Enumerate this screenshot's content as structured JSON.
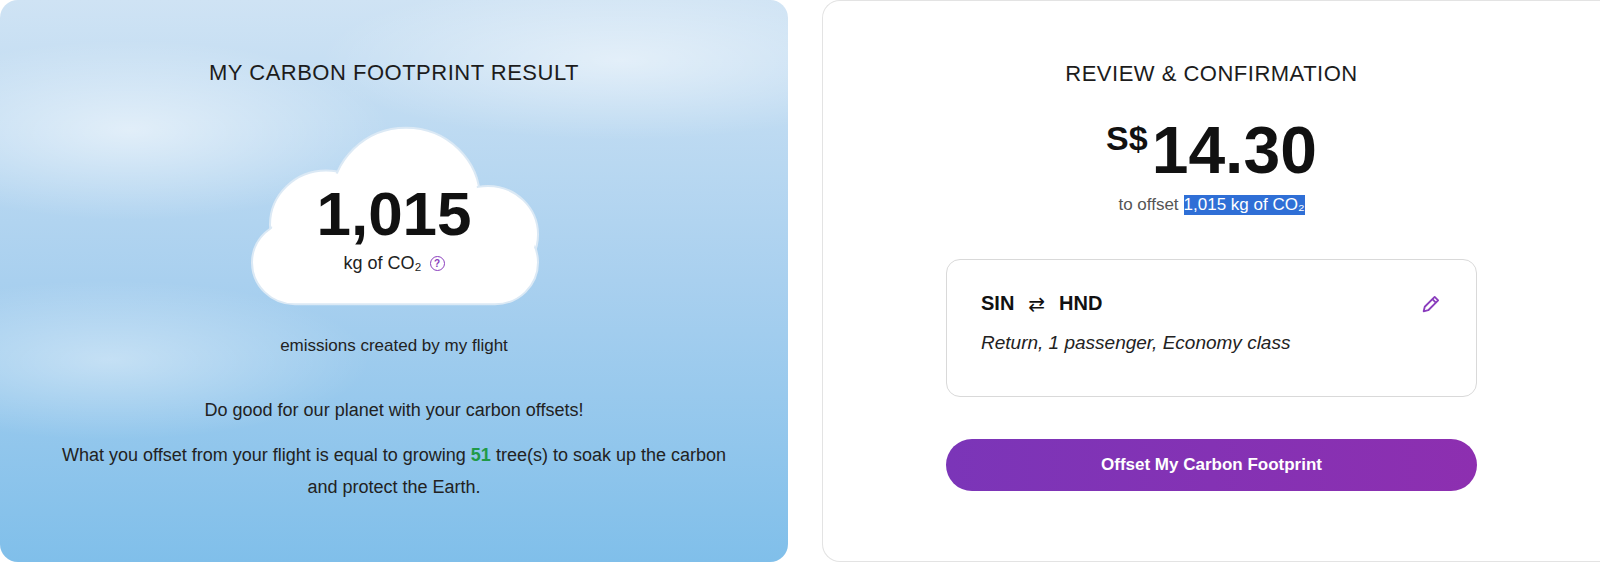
{
  "result": {
    "title": "MY CARBON FOOTPRINT RESULT",
    "amount": "1,015",
    "unit": "kg of CO₂",
    "help_icon": "?",
    "caption": "emissions created by my flight",
    "slogan": "Do good for our planet with your carbon offsets!",
    "equivalence": {
      "before": "What you offset from your flight is equal to growing ",
      "trees": "51",
      "after": " tree(s) to soak up the carbon and protect the Earth."
    }
  },
  "review": {
    "title": "REVIEW & CONFIRMATION",
    "currency": "S$",
    "price": "14.30",
    "offset_label": "to offset",
    "offset_amount": "1,015 kg of CO₂",
    "offset_selected": true,
    "route": {
      "from": "SIN",
      "swap_icon": "⇄",
      "to": "HND",
      "details": "Return, 1 passenger, Economy class"
    },
    "button": "Offset My Carbon Footprint"
  }
}
